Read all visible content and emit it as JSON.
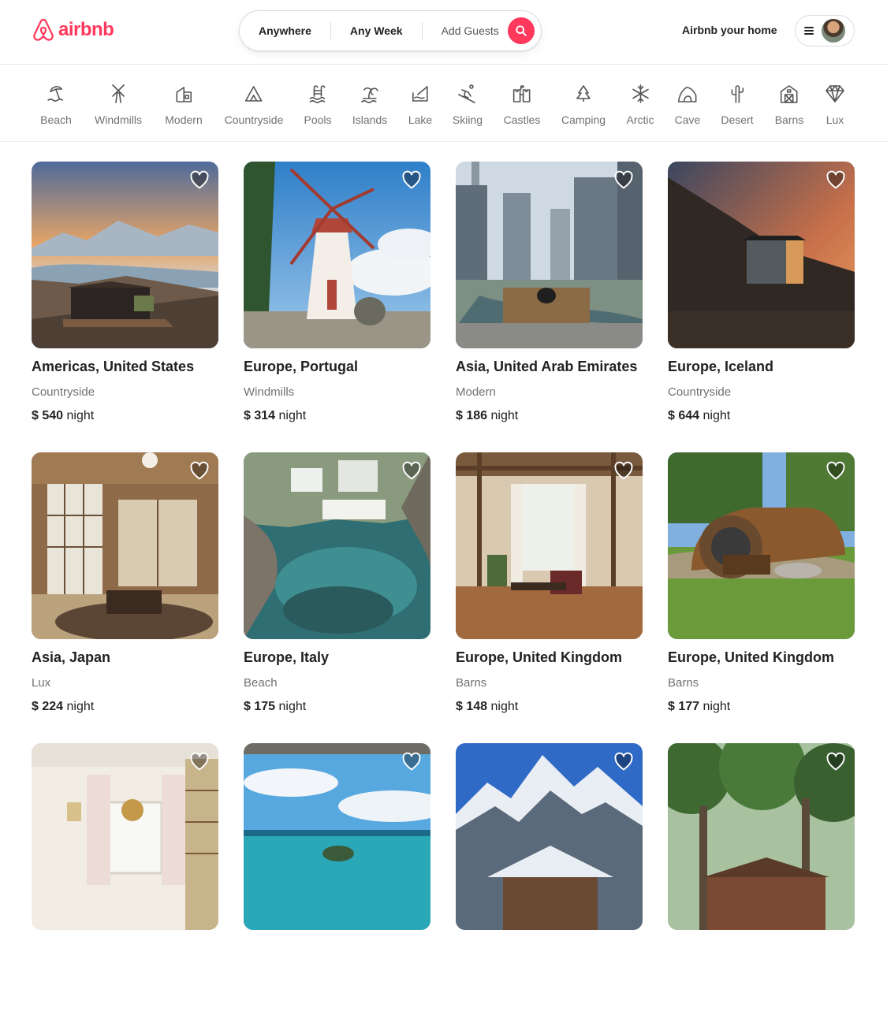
{
  "header": {
    "logo_text": "airbnb",
    "search": {
      "where": "Anywhere",
      "when": "Any Week",
      "who": "Add Guests"
    },
    "host_link": "Airbnb your home",
    "accent": "#FF385C"
  },
  "categories": [
    {
      "label": "Beach",
      "icon": "beach-icon"
    },
    {
      "label": "Windmills",
      "icon": "windmill-icon"
    },
    {
      "label": "Modern",
      "icon": "modern-house-icon"
    },
    {
      "label": "Countryside",
      "icon": "countryside-icon"
    },
    {
      "label": "Pools",
      "icon": "pool-icon"
    },
    {
      "label": "Islands",
      "icon": "island-icon"
    },
    {
      "label": "Lake",
      "icon": "lake-icon"
    },
    {
      "label": "Skiing",
      "icon": "skiing-icon"
    },
    {
      "label": "Castles",
      "icon": "castle-icon"
    },
    {
      "label": "Camping",
      "icon": "camping-icon"
    },
    {
      "label": "Arctic",
      "icon": "snowflake-icon"
    },
    {
      "label": "Cave",
      "icon": "cave-icon"
    },
    {
      "label": "Desert",
      "icon": "cactus-icon"
    },
    {
      "label": "Barns",
      "icon": "barn-icon"
    },
    {
      "label": "Lux",
      "icon": "diamond-icon"
    }
  ],
  "listings": [
    {
      "location": "Americas, United States",
      "category": "Countryside",
      "price": "$ 540",
      "unit": "night"
    },
    {
      "location": "Europe, Portugal",
      "category": "Windmills",
      "price": "$ 314",
      "unit": "night"
    },
    {
      "location": "Asia, United Arab Emirates",
      "category": "Modern",
      "price": "$ 186",
      "unit": "night"
    },
    {
      "location": "Europe, Iceland",
      "category": "Countryside",
      "price": "$ 644",
      "unit": "night"
    },
    {
      "location": "Asia, Japan",
      "category": "Lux",
      "price": "$ 224",
      "unit": "night"
    },
    {
      "location": "Europe, Italy",
      "category": "Beach",
      "price": "$ 175",
      "unit": "night"
    },
    {
      "location": "Europe, United Kingdom",
      "category": "Barns",
      "price": "$ 148",
      "unit": "night"
    },
    {
      "location": "Europe, United Kingdom",
      "category": "Barns",
      "price": "$ 177",
      "unit": "night"
    },
    {
      "location": "",
      "category": "",
      "price": "",
      "unit": ""
    },
    {
      "location": "",
      "category": "",
      "price": "",
      "unit": ""
    },
    {
      "location": "",
      "category": "",
      "price": "",
      "unit": ""
    },
    {
      "location": "",
      "category": "",
      "price": "",
      "unit": ""
    }
  ]
}
